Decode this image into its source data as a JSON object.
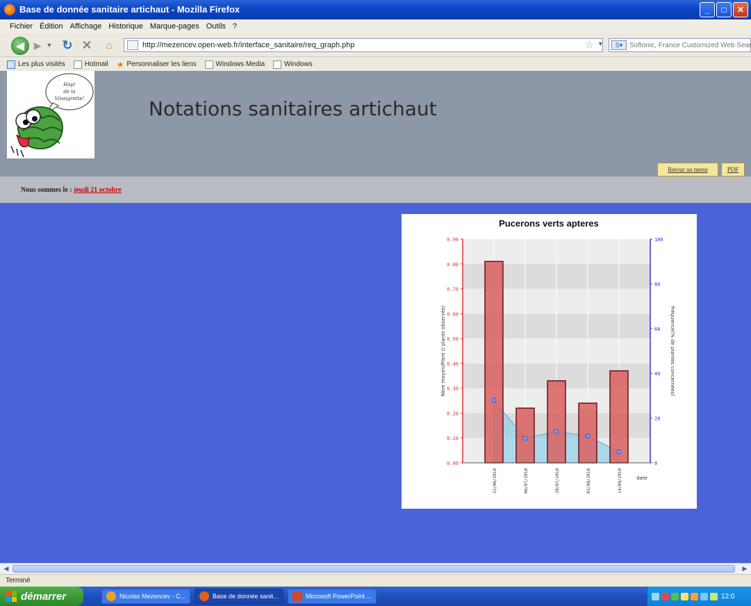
{
  "window": {
    "title": "Base de donnée sanitaire artichaut - Mozilla Firefox"
  },
  "menu": [
    "Fichier",
    "Édition",
    "Affichage",
    "Historique",
    "Marque-pages",
    "Outils",
    "?"
  ],
  "nav": {
    "url": "http://mezencev.open-web.fr/interface_sanitaire/req_graph.php",
    "search_placeholder": "Softonic, France Customized Web Search"
  },
  "bookmarks": [
    "Les plus visités",
    "Hotmail",
    "Personnaliser les liens",
    "Windows Media",
    "Windows"
  ],
  "page": {
    "title": "Notations sanitaires artichaut",
    "logo_bubble": "Hop! de la Vinaigrette!",
    "btn_retour": "Retour au menu",
    "btn_pdf": "PDF",
    "date_prefix": "Nous sommes le : ",
    "date_value": "jeudi 21 octobre"
  },
  "chart_data": {
    "type": "bar",
    "title": "Pucerons verts apteres",
    "xlabel": "date",
    "ylabel": "Nbre moyen/Plant (/ plants observés)",
    "y2label": "Fréquence(% de plantes concernées)",
    "categories": [
      "23/06/2010",
      "06/07/2010",
      "20/07/2010",
      "03/08/2010",
      "14/09/2010"
    ],
    "ylim": [
      0,
      0.9
    ],
    "y2lim": [
      0,
      100
    ],
    "yticks": [
      "0.00",
      "0.10",
      "0.20",
      "0.30",
      "0.40",
      "0.50",
      "0.60",
      "0.70",
      "0.80",
      "0.90"
    ],
    "y2ticks": [
      "0",
      "20",
      "40",
      "60",
      "80",
      "100"
    ],
    "series": [
      {
        "kind": "bar",
        "values": [
          0.81,
          0.22,
          0.33,
          0.24,
          0.37
        ],
        "color": "#d95f5f"
      },
      {
        "kind": "area",
        "axis": "y2",
        "values": [
          28,
          11,
          14,
          12,
          5
        ],
        "color": "#8fd0ea"
      }
    ]
  },
  "status": {
    "text": "Terminé"
  },
  "taskbar": {
    "start_label": "démarrer",
    "tasks": [
      "Nicolas Mezencev - C...",
      "Base de donnée sanit...",
      "Microsoft PowerPoint ..."
    ],
    "clock": "12:0"
  }
}
